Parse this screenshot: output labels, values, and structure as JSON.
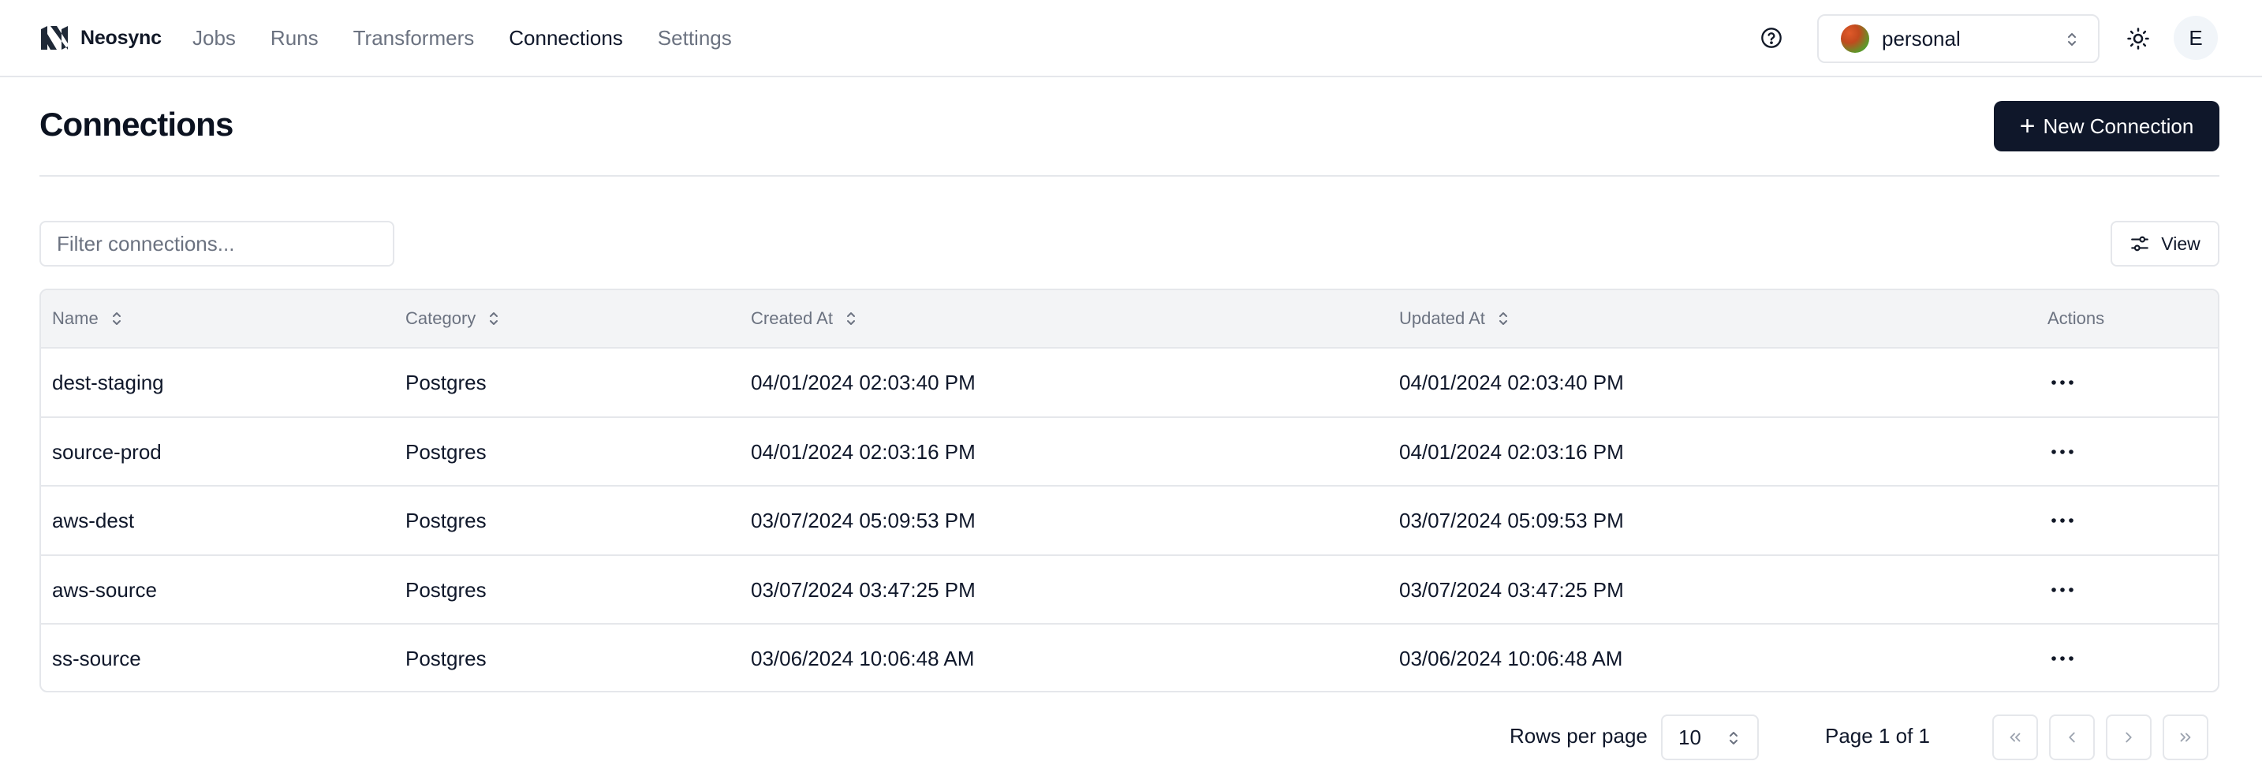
{
  "brand": {
    "name": "Neosync"
  },
  "nav": {
    "items": [
      {
        "label": "Jobs",
        "active": false
      },
      {
        "label": "Runs",
        "active": false
      },
      {
        "label": "Transformers",
        "active": false
      },
      {
        "label": "Connections",
        "active": true
      },
      {
        "label": "Settings",
        "active": false
      }
    ]
  },
  "header_actions": {
    "help_icon": "question-circle-icon",
    "account": {
      "name": "personal",
      "icon": "chevron-up-down-icon"
    },
    "theme_icon": "sun-icon",
    "user_initial": "E"
  },
  "page": {
    "title": "Connections",
    "new_button": {
      "label": "New Connection",
      "icon": "plus-icon"
    }
  },
  "toolbar": {
    "filter_placeholder": "Filter connections...",
    "filter_value": "",
    "view_button": {
      "label": "View",
      "icon": "sliders-icon"
    }
  },
  "table": {
    "columns": [
      "Name",
      "Category",
      "Created At",
      "Updated At",
      "Actions"
    ],
    "rows": [
      {
        "name": "dest-staging",
        "category": "Postgres",
        "created_at": "04/01/2024 02:03:40 PM",
        "updated_at": "04/01/2024 02:03:40 PM"
      },
      {
        "name": "source-prod",
        "category": "Postgres",
        "created_at": "04/01/2024 02:03:16 PM",
        "updated_at": "04/01/2024 02:03:16 PM"
      },
      {
        "name": "aws-dest",
        "category": "Postgres",
        "created_at": "03/07/2024 05:09:53 PM",
        "updated_at": "03/07/2024 05:09:53 PM"
      },
      {
        "name": "aws-source",
        "category": "Postgres",
        "created_at": "03/07/2024 03:47:25 PM",
        "updated_at": "03/07/2024 03:47:25 PM"
      },
      {
        "name": "ss-source",
        "category": "Postgres",
        "created_at": "03/06/2024 10:06:48 AM",
        "updated_at": "03/06/2024 10:06:48 AM"
      }
    ]
  },
  "pagination": {
    "rows_per_page_label": "Rows per page",
    "rows_per_page": "10",
    "page_info": "Page 1 of 1"
  },
  "colors": {
    "primary": "#0f172a",
    "muted_text": "#6b7280",
    "border": "#e5e7eb",
    "header_bg": "#f3f4f6"
  }
}
